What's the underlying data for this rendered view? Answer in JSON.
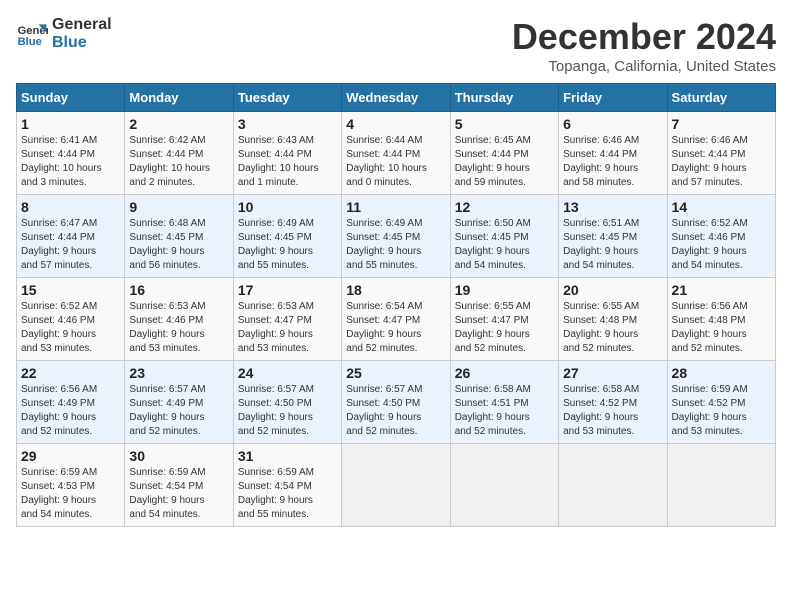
{
  "logo": {
    "line1": "General",
    "line2": "Blue"
  },
  "title": "December 2024",
  "subtitle": "Topanga, California, United States",
  "weekdays": [
    "Sunday",
    "Monday",
    "Tuesday",
    "Wednesday",
    "Thursday",
    "Friday",
    "Saturday"
  ],
  "weeks": [
    [
      {
        "day": "1",
        "info": "Sunrise: 6:41 AM\nSunset: 4:44 PM\nDaylight: 10 hours\nand 3 minutes."
      },
      {
        "day": "2",
        "info": "Sunrise: 6:42 AM\nSunset: 4:44 PM\nDaylight: 10 hours\nand 2 minutes."
      },
      {
        "day": "3",
        "info": "Sunrise: 6:43 AM\nSunset: 4:44 PM\nDaylight: 10 hours\nand 1 minute."
      },
      {
        "day": "4",
        "info": "Sunrise: 6:44 AM\nSunset: 4:44 PM\nDaylight: 10 hours\nand 0 minutes."
      },
      {
        "day": "5",
        "info": "Sunrise: 6:45 AM\nSunset: 4:44 PM\nDaylight: 9 hours\nand 59 minutes."
      },
      {
        "day": "6",
        "info": "Sunrise: 6:46 AM\nSunset: 4:44 PM\nDaylight: 9 hours\nand 58 minutes."
      },
      {
        "day": "7",
        "info": "Sunrise: 6:46 AM\nSunset: 4:44 PM\nDaylight: 9 hours\nand 57 minutes."
      }
    ],
    [
      {
        "day": "8",
        "info": "Sunrise: 6:47 AM\nSunset: 4:44 PM\nDaylight: 9 hours\nand 57 minutes."
      },
      {
        "day": "9",
        "info": "Sunrise: 6:48 AM\nSunset: 4:45 PM\nDaylight: 9 hours\nand 56 minutes."
      },
      {
        "day": "10",
        "info": "Sunrise: 6:49 AM\nSunset: 4:45 PM\nDaylight: 9 hours\nand 55 minutes."
      },
      {
        "day": "11",
        "info": "Sunrise: 6:49 AM\nSunset: 4:45 PM\nDaylight: 9 hours\nand 55 minutes."
      },
      {
        "day": "12",
        "info": "Sunrise: 6:50 AM\nSunset: 4:45 PM\nDaylight: 9 hours\nand 54 minutes."
      },
      {
        "day": "13",
        "info": "Sunrise: 6:51 AM\nSunset: 4:45 PM\nDaylight: 9 hours\nand 54 minutes."
      },
      {
        "day": "14",
        "info": "Sunrise: 6:52 AM\nSunset: 4:46 PM\nDaylight: 9 hours\nand 54 minutes."
      }
    ],
    [
      {
        "day": "15",
        "info": "Sunrise: 6:52 AM\nSunset: 4:46 PM\nDaylight: 9 hours\nand 53 minutes."
      },
      {
        "day": "16",
        "info": "Sunrise: 6:53 AM\nSunset: 4:46 PM\nDaylight: 9 hours\nand 53 minutes."
      },
      {
        "day": "17",
        "info": "Sunrise: 6:53 AM\nSunset: 4:47 PM\nDaylight: 9 hours\nand 53 minutes."
      },
      {
        "day": "18",
        "info": "Sunrise: 6:54 AM\nSunset: 4:47 PM\nDaylight: 9 hours\nand 52 minutes."
      },
      {
        "day": "19",
        "info": "Sunrise: 6:55 AM\nSunset: 4:47 PM\nDaylight: 9 hours\nand 52 minutes."
      },
      {
        "day": "20",
        "info": "Sunrise: 6:55 AM\nSunset: 4:48 PM\nDaylight: 9 hours\nand 52 minutes."
      },
      {
        "day": "21",
        "info": "Sunrise: 6:56 AM\nSunset: 4:48 PM\nDaylight: 9 hours\nand 52 minutes."
      }
    ],
    [
      {
        "day": "22",
        "info": "Sunrise: 6:56 AM\nSunset: 4:49 PM\nDaylight: 9 hours\nand 52 minutes."
      },
      {
        "day": "23",
        "info": "Sunrise: 6:57 AM\nSunset: 4:49 PM\nDaylight: 9 hours\nand 52 minutes."
      },
      {
        "day": "24",
        "info": "Sunrise: 6:57 AM\nSunset: 4:50 PM\nDaylight: 9 hours\nand 52 minutes."
      },
      {
        "day": "25",
        "info": "Sunrise: 6:57 AM\nSunset: 4:50 PM\nDaylight: 9 hours\nand 52 minutes."
      },
      {
        "day": "26",
        "info": "Sunrise: 6:58 AM\nSunset: 4:51 PM\nDaylight: 9 hours\nand 52 minutes."
      },
      {
        "day": "27",
        "info": "Sunrise: 6:58 AM\nSunset: 4:52 PM\nDaylight: 9 hours\nand 53 minutes."
      },
      {
        "day": "28",
        "info": "Sunrise: 6:59 AM\nSunset: 4:52 PM\nDaylight: 9 hours\nand 53 minutes."
      }
    ],
    [
      {
        "day": "29",
        "info": "Sunrise: 6:59 AM\nSunset: 4:53 PM\nDaylight: 9 hours\nand 54 minutes."
      },
      {
        "day": "30",
        "info": "Sunrise: 6:59 AM\nSunset: 4:54 PM\nDaylight: 9 hours\nand 54 minutes."
      },
      {
        "day": "31",
        "info": "Sunrise: 6:59 AM\nSunset: 4:54 PM\nDaylight: 9 hours\nand 55 minutes."
      },
      {
        "day": "",
        "info": ""
      },
      {
        "day": "",
        "info": ""
      },
      {
        "day": "",
        "info": ""
      },
      {
        "day": "",
        "info": ""
      }
    ]
  ]
}
